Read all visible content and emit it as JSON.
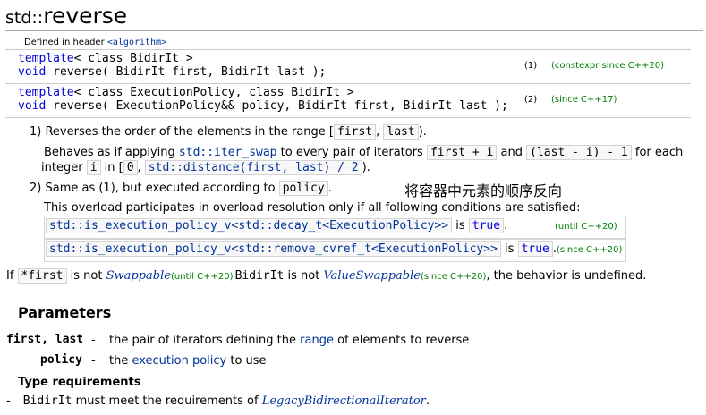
{
  "title": {
    "prefix": "std::",
    "name": "reverse"
  },
  "header_note": {
    "text": "Defined in header ",
    "header": "<algorithm>"
  },
  "declarations": [
    {
      "line1": {
        "kw1": "template",
        "rest": "< class BidirIt >"
      },
      "line2": {
        "kw": "void",
        "rest": " reverse( BidirIt first, BidirIt last );"
      },
      "num": "(1)",
      "note": "(constexpr since C++20)"
    },
    {
      "line1": {
        "kw1": "template",
        "rest": "< class ExecutionPolicy, class BidirIt >"
      },
      "line2": {
        "kw": "void",
        "rest": " reverse( ExecutionPolicy&& policy, BidirIt first, BidirIt last );"
      },
      "num": "(2)",
      "note": "(since C++17)"
    }
  ],
  "desc1": {
    "lead": "1) Reverses the order of the elements in the range [",
    "first": "first",
    "comma": ", ",
    "last": "last",
    "close": ")."
  },
  "desc1b": {
    "a": "Behaves as if applying ",
    "fn": "std::iter_swap",
    "b": " to every pair of iterators ",
    "c1": "first + i",
    "d": " and ",
    "c2": "(last - i) - 1",
    "e": " for each"
  },
  "desc1c": {
    "a": "integer ",
    "i": "i",
    "b": " in [",
    "zero": "0",
    "comma": ", ",
    "dist": "std::distance(first, last) / 2",
    "close": ")."
  },
  "desc2": {
    "a": "2) Same as (1), but executed according to ",
    "policy": "policy",
    "b": "."
  },
  "chinese_note": "将容器中元素的顺序反向",
  "overload_note": "This overload participates in overload resolution only if all following conditions are satisfied:",
  "conditions": [
    {
      "code": "std::is_execution_policy_v<std::decay_t<ExecutionPolicy>>",
      "is": " is ",
      "val": "true",
      "dot": ".",
      "note": "(until C++20)"
    },
    {
      "code": "std::is_execution_policy_v<std::remove_cvref_t<ExecutionPolicy>>",
      "is": " is ",
      "val": "true",
      "dot": ".",
      "note": "(since C++20)"
    }
  ],
  "if_line": {
    "if": "If ",
    "expr": "*first",
    "notis": " is not ",
    "swappable": "Swappable",
    "until": "(until C++20)",
    "bidir": "BidirIt",
    "notis2": " is not ",
    "valueswap": "ValueSwappable",
    "since": "(since C++20)",
    "rest": ", the behavior is undefined."
  },
  "params_heading": "Parameters",
  "params": [
    {
      "name": "first, last",
      "dash": "-",
      "a": "the pair of iterators defining the ",
      "link": "range",
      "b": " of elements to reverse"
    },
    {
      "name": "policy",
      "dash": "-",
      "a": "the ",
      "link": "execution policy",
      "b": " to use"
    }
  ],
  "type_req_heading": "Type requirements",
  "type_req": {
    "dash": "-",
    "name": "BidirIt",
    "a": " must meet the requirements of ",
    "link": "LegacyBidirectionalIterator",
    "b": "."
  }
}
